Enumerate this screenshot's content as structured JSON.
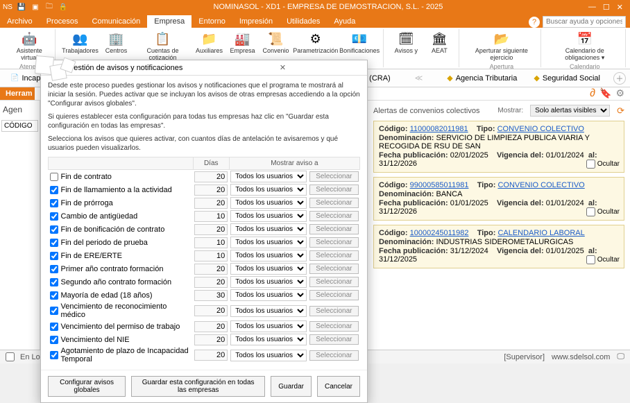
{
  "titlebar": {
    "title": "NOMINASOL - XD1 - EMPRESA DE DEMOSTRACION, S.L. - 2025"
  },
  "menu": {
    "items": [
      "Archivo",
      "Procesos",
      "Comunicación",
      "Empresa",
      "Entorno",
      "Impresión",
      "Utilidades",
      "Ayuda"
    ],
    "active": "Empresa",
    "help_placeholder": "Buscar ayuda y opciones"
  },
  "ribbon": {
    "groups": [
      {
        "label": "Atenea",
        "buttons": [
          {
            "label": "Asistente virtual",
            "icon": "🤖"
          }
        ]
      },
      {
        "label": "",
        "buttons": [
          {
            "label": "Trabajadores",
            "icon": "👥"
          },
          {
            "label": "Centros",
            "icon": "🏢"
          },
          {
            "label": "Cuentas de cotización",
            "icon": "📋"
          },
          {
            "label": "Auxiliares",
            "icon": "📁"
          },
          {
            "label": "Empresa",
            "icon": "🏭"
          },
          {
            "label": "Convenio",
            "icon": "📜"
          },
          {
            "label": "Parametrización",
            "icon": "⚙"
          },
          {
            "label": "Bonificaciones",
            "icon": "💶"
          }
        ]
      },
      {
        "label": "",
        "buttons": [
          {
            "label": "Avisos y",
            "icon": "🗓"
          },
          {
            "label": "AEAT",
            "icon": "🏛"
          }
        ]
      },
      {
        "label": "Apertura",
        "buttons": [
          {
            "label": "Aperturar siguiente ejercicio",
            "icon": "📂"
          }
        ]
      },
      {
        "label": "Calendario",
        "buttons": [
          {
            "label": "Calendario de obligaciones ▾",
            "icon": "📅"
          }
        ]
      }
    ]
  },
  "toolbar2": {
    "left": "Incap",
    "mid": "s (CRA)",
    "agencia": "Agencia Tributaria",
    "seg": "Seguridad Social"
  },
  "herram": "Herram",
  "leftcol": {
    "agen": "Agen",
    "codigo": "CÓDIGO"
  },
  "dialog": {
    "title": "Gestión de avisos y notificaciones",
    "intro1": "Desde este proceso puedes gestionar los avisos y notificaciones que el programa te mostrará al iniciar la sesión. Puedes activar que se incluyan los avisos de otras empresas accediendo a la opción \"Configurar avisos globales\".",
    "intro2": "Si quieres establecer esta configuración para todas tus empresas haz clic en \"Guardar esta configuración en todas las empresas\".",
    "intro3": "Selecciona los avisos que quieres activar, con cuantos días de antelación te avisaremos y qué usuarios pueden visualizarlos.",
    "col_dias": "Días",
    "col_mostrar": "Mostrar aviso a",
    "audience": "Todos los usuarios",
    "select_btn": "Seleccionar",
    "rows": [
      {
        "label": "Fin de contrato",
        "checked": false,
        "dias": "20"
      },
      {
        "label": "Fin de llamamiento a la actividad",
        "checked": true,
        "dias": "20"
      },
      {
        "label": "Fin de prórroga",
        "checked": true,
        "dias": "20"
      },
      {
        "label": "Cambio de antigüedad",
        "checked": true,
        "dias": "10"
      },
      {
        "label": "Fin de bonificación de contrato",
        "checked": true,
        "dias": "20"
      },
      {
        "label": "Fin del periodo de prueba",
        "checked": true,
        "dias": "10"
      },
      {
        "label": "Fin de ERE/ERTE",
        "checked": true,
        "dias": "10"
      },
      {
        "label": "Primer año contrato formación",
        "checked": true,
        "dias": "20"
      },
      {
        "label": "Segundo año contrato formación",
        "checked": true,
        "dias": "20"
      },
      {
        "label": "Mayoría de edad (18 años)",
        "checked": true,
        "dias": "30"
      },
      {
        "label": "Vencimiento de reconocimiento médico",
        "checked": true,
        "dias": "20"
      },
      {
        "label": "Vencimiento del permiso de trabajo",
        "checked": true,
        "dias": "20"
      },
      {
        "label": "Vencimiento del NIE",
        "checked": true,
        "dias": "20"
      },
      {
        "label": "Agotamiento de plazo de Incapacidad Temporal",
        "checked": true,
        "dias": "20"
      }
    ],
    "footer": {
      "globales": "Configurar avisos globales",
      "guardar_todas": "Guardar esta configuración en todas las empresas",
      "guardar": "Guardar",
      "cancelar": "Cancelar"
    }
  },
  "alerts": {
    "title": "Alertas de convenios colectivos",
    "mostrar_lbl": "Mostrar:",
    "mostrar_val": "Solo alertas visibles",
    "labels": {
      "codigo": "Código:",
      "tipo": "Tipo:",
      "denom": "Denominación:",
      "fpub": "Fecha publicación:",
      "vig": "Vigencia del:",
      "al": "al:",
      "ocultar": "Ocultar"
    },
    "cards": [
      {
        "codigo": "11000082011981",
        "tipo": "CONVENIO COLECTIVO",
        "denom": "SERVICIO DE LIMPIEZA PUBLICA VIARIA Y RECOGIDA DE RSU DE SAN",
        "fpub": "02/01/2025",
        "vdel": "01/01/2024",
        "val": "31/12/2026"
      },
      {
        "codigo": "99000585011981",
        "tipo": "CONVENIO COLECTIVO",
        "denom": "BANCA",
        "fpub": "01/01/2025",
        "vdel": "01/01/2024",
        "val": "31/12/2026"
      },
      {
        "codigo": "10000245011982",
        "tipo": "CALENDARIO LABORAL",
        "denom": "INDUSTRIAS SIDEROMETALURGICAS",
        "fpub": "31/12/2024",
        "vdel": "01/01/2025",
        "val": "31/12/2025"
      }
    ]
  },
  "status": {
    "enlocal": "En Local",
    "supervisor": "[Supervisor]",
    "site": "www.sdelsol.com"
  }
}
